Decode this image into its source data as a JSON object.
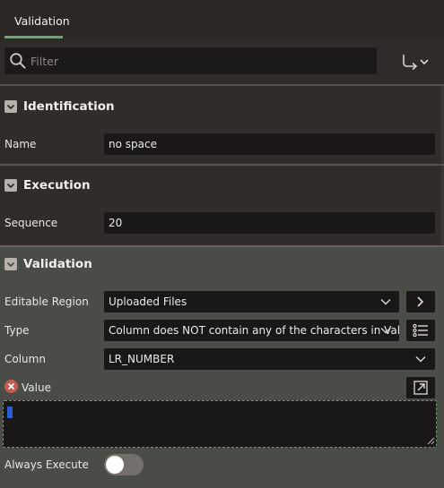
{
  "tabs": [
    {
      "label": "Validation",
      "active": true
    }
  ],
  "filter": {
    "placeholder": "Filter"
  },
  "sections": {
    "identification": {
      "title": "Identification",
      "fields": {
        "name": {
          "label": "Name",
          "value": "no space"
        }
      }
    },
    "execution": {
      "title": "Execution",
      "fields": {
        "sequence": {
          "label": "Sequence",
          "value": "20"
        }
      }
    },
    "validation": {
      "title": "Validation",
      "fields": {
        "editable_region": {
          "label": "Editable Region",
          "value": "Uploaded Files"
        },
        "type": {
          "label": "Type",
          "value": "Column does NOT contain any of the characters in Value"
        },
        "column": {
          "label": "Column",
          "value": "LR_NUMBER"
        },
        "value": {
          "label": "Value",
          "value": "",
          "has_error": true
        },
        "always_execute": {
          "label": "Always Execute",
          "on": false
        }
      }
    }
  },
  "icons": {
    "search": "search-icon",
    "goto": "goto-arrow-icon",
    "chevron_right": "chevron-right-icon",
    "list": "list-icon",
    "open_dialog": "open-dialog-icon",
    "error": "error-icon"
  },
  "colors": {
    "tab_accent": "#7d9e7a",
    "error": "#c85a52",
    "validation_bg": "#4a4d45"
  }
}
